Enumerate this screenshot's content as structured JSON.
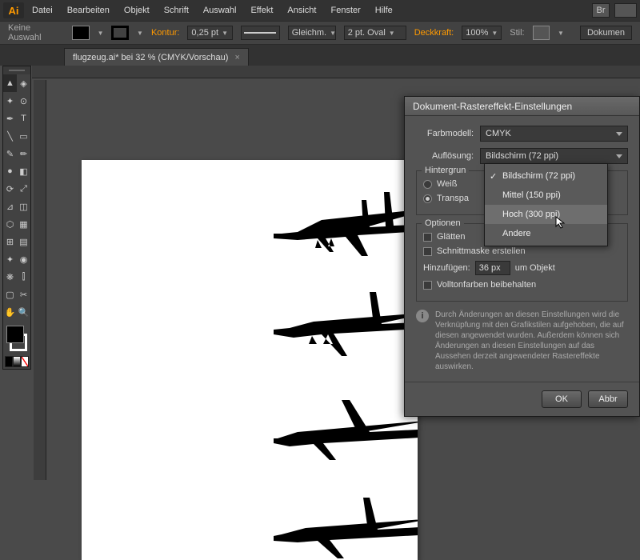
{
  "app": {
    "logo": "Ai"
  },
  "menu": [
    "Datei",
    "Bearbeiten",
    "Objekt",
    "Schrift",
    "Auswahl",
    "Effekt",
    "Ansicht",
    "Fenster",
    "Hilfe"
  ],
  "menu_right_label": "Br",
  "control": {
    "selection": "Keine Auswahl",
    "kontur_label": "Kontur:",
    "stroke_width": "0,25 pt",
    "stroke_style": "Gleichm.",
    "brush": "2 pt. Oval",
    "opacity_label": "Deckkraft:",
    "opacity": "100%",
    "style_label": "Stil:",
    "setup_btn": "Dokumen"
  },
  "tab": {
    "title": "flugzeug.ai* bei 32 % (CMYK/Vorschau)",
    "close": "×"
  },
  "dialog": {
    "title": "Dokument-Rastereffekt-Einstellungen",
    "farbmodell_label": "Farbmodell:",
    "farbmodell_value": "CMYK",
    "aufloesung_label": "Auflösung:",
    "aufloesung_value": "Bildschirm (72 ppi)",
    "hintergrund_title": "Hintergrun",
    "weiss": "Weiß",
    "transparent": "Transpa",
    "optionen_title": "Optionen",
    "glaetten": "Glätten",
    "schnittmaske": "Schnittmaske erstellen",
    "hinzufuegen_label": "Hinzufügen:",
    "hinzufuegen_value": "36 px",
    "hinzufuegen_suffix": "um Objekt",
    "volltonfarben": "Volltonfarben beibehalten",
    "info": "Durch Änderungen an diesen Einstellungen wird die Verknüpfung mit den Grafikstilen aufgehoben, die auf diesen angewendet wurden. Außerdem können sich Änderungen an diesen Einstellungen auf das Aussehen derzeit angewendeter Rastereffekte auswirken.",
    "ok": "OK",
    "cancel": "Abbr"
  },
  "dropdown": {
    "items": [
      {
        "label": "Bildschirm (72 ppi)",
        "checked": true,
        "hover": false
      },
      {
        "label": "Mittel (150 ppi)",
        "checked": false,
        "hover": false
      },
      {
        "label": "Hoch (300 ppi)",
        "checked": false,
        "hover": true
      },
      {
        "label": "Andere",
        "checked": false,
        "hover": false
      }
    ]
  },
  "colors": {
    "accent": "#ff9a00",
    "panel": "#535353"
  }
}
